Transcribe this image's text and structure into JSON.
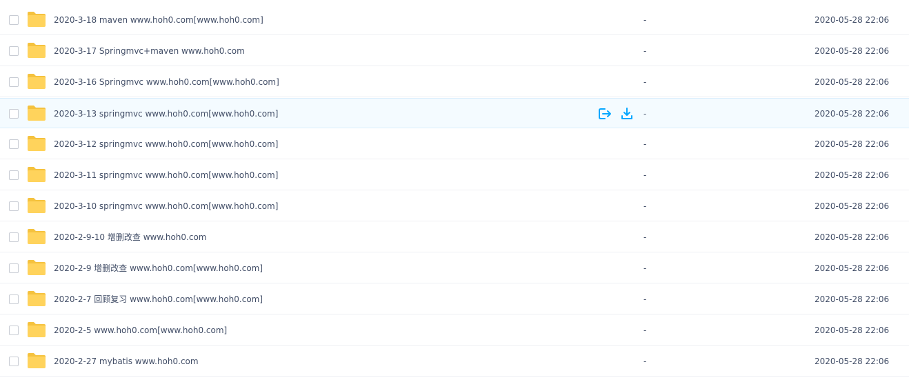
{
  "files": [
    {
      "name": "2020-3-18 maven www.hoh0.com[www.hoh0.com]",
      "size": "-",
      "modified": "2020-05-28 22:06"
    },
    {
      "name": "2020-3-17 Springmvc+maven www.hoh0.com",
      "size": "-",
      "modified": "2020-05-28 22:06"
    },
    {
      "name": "2020-3-16 Springmvc www.hoh0.com[www.hoh0.com]",
      "size": "-",
      "modified": "2020-05-28 22:06"
    },
    {
      "name": "2020-3-13 springmvc www.hoh0.com[www.hoh0.com]",
      "size": "-",
      "modified": "2020-05-28 22:06",
      "hovered": true
    },
    {
      "name": "2020-3-12 springmvc www.hoh0.com[www.hoh0.com]",
      "size": "-",
      "modified": "2020-05-28 22:06"
    },
    {
      "name": "2020-3-11 springmvc www.hoh0.com[www.hoh0.com]",
      "size": "-",
      "modified": "2020-05-28 22:06"
    },
    {
      "name": "2020-3-10 springmvc www.hoh0.com[www.hoh0.com]",
      "size": "-",
      "modified": "2020-05-28 22:06"
    },
    {
      "name": "2020-2-9-10 增删改查 www.hoh0.com",
      "size": "-",
      "modified": "2020-05-28 22:06"
    },
    {
      "name": "2020-2-9 增删改查 www.hoh0.com[www.hoh0.com]",
      "size": "-",
      "modified": "2020-05-28 22:06"
    },
    {
      "name": "2020-2-7 回顾复习 www.hoh0.com[www.hoh0.com]",
      "size": "-",
      "modified": "2020-05-28 22:06"
    },
    {
      "name": "2020-2-5 www.hoh0.com[www.hoh0.com]",
      "size": "-",
      "modified": "2020-05-28 22:06"
    },
    {
      "name": "2020-2-27 mybatis www.hoh0.com",
      "size": "-",
      "modified": "2020-05-28 22:06"
    }
  ],
  "icons": {
    "row_icon": "folder-icon",
    "share_action": "share-icon",
    "download_action": "download-icon"
  },
  "colors": {
    "folder": "#ffd35c",
    "folder_tab": "#f5c23e",
    "accent": "#06a7ff",
    "hover_row": "#f4fbff",
    "text": "#424e67"
  }
}
